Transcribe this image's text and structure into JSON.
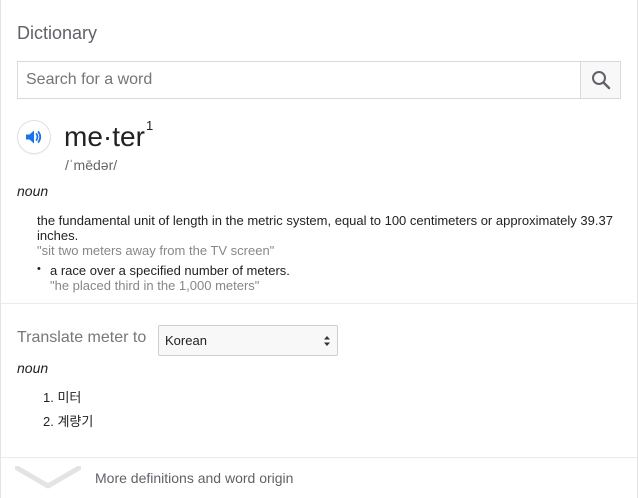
{
  "dictionary": {
    "title": "Dictionary",
    "search": {
      "placeholder": "Search for a word",
      "value": ""
    },
    "entry": {
      "word": "me·ter",
      "superscript": "1",
      "phonetic": "/ˈmēdər/",
      "part_of_speech": "noun",
      "definitions": [
        {
          "text": "the fundamental unit of length in the metric system, equal to 100 centimeters or approximately 39.37 inches.",
          "example": "\"sit two meters away from the TV screen\""
        },
        {
          "bullet": "•",
          "text": "a race over a specified number of meters.",
          "example": "\"he placed third in the 1,000 meters\""
        }
      ]
    },
    "translate": {
      "label": "Translate meter to",
      "selected_language": "Korean",
      "part_of_speech": "noun",
      "items": [
        {
          "number": "1.",
          "text": "미터"
        },
        {
          "number": "2.",
          "text": "계량기"
        }
      ]
    },
    "more_link": "More definitions and word origin"
  },
  "icons": {
    "search": "search-icon",
    "speaker": "speaker-icon",
    "select_arrows": "updown-arrows-icon",
    "expand": "chevron-down-icon"
  },
  "colors": {
    "speaker_accent": "#1a73e8",
    "example_text": "#878787",
    "muted_label": "#777777"
  }
}
